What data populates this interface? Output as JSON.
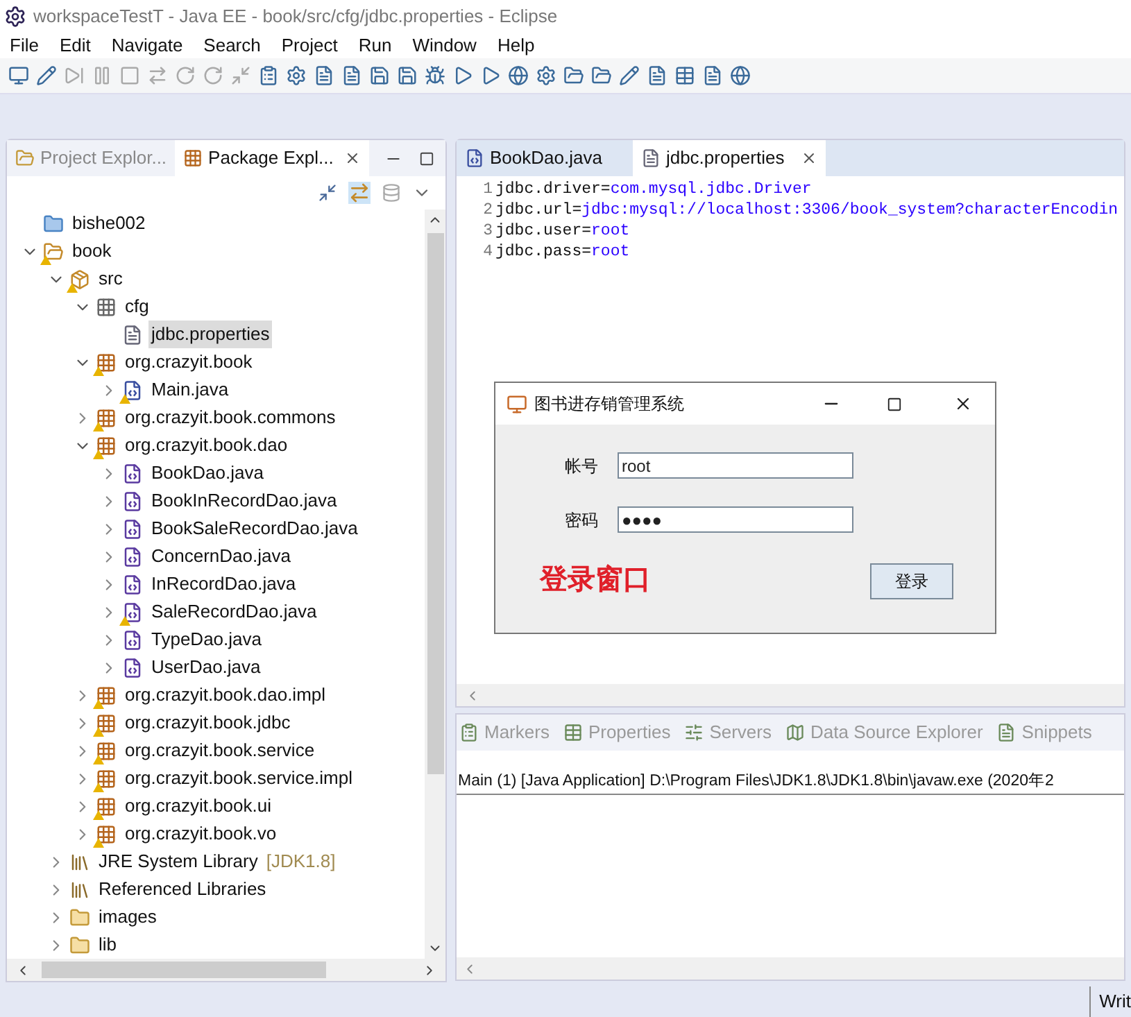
{
  "window": {
    "title": "workspaceTestT - Java EE - book/src/cfg/jdbc.properties - Eclipse"
  },
  "menu": [
    "File",
    "Edit",
    "Navigate",
    "Search",
    "Project",
    "Run",
    "Window",
    "Help"
  ],
  "left_tabs": [
    {
      "label": "Project Explor...",
      "selected": false,
      "closable": false
    },
    {
      "label": "Package Expl...",
      "selected": true,
      "closable": true
    }
  ],
  "tree": [
    {
      "label": "bishe002",
      "kind": "project",
      "has_children": false,
      "warning": false,
      "selected": false
    },
    {
      "label": "book",
      "kind": "java-project",
      "has_children": true,
      "expanded": true,
      "warning": true,
      "selected": false,
      "children": [
        {
          "label": "src",
          "kind": "source-folder",
          "has_children": true,
          "expanded": true,
          "warning": true,
          "selected": false,
          "children": [
            {
              "label": "cfg",
              "kind": "empty-package",
              "has_children": true,
              "expanded": true,
              "warning": false,
              "selected": false,
              "children": [
                {
                  "label": "jdbc.properties",
                  "kind": "file",
                  "has_children": false,
                  "warning": false,
                  "selected": true
                }
              ]
            },
            {
              "label": "org.crazyit.book",
              "kind": "package",
              "has_children": true,
              "expanded": true,
              "warning": true,
              "selected": false,
              "children": [
                {
                  "label": "Main.java",
                  "kind": "java",
                  "has_children": true,
                  "expanded": false,
                  "warning": true,
                  "selected": false
                }
              ]
            },
            {
              "label": "org.crazyit.book.commons",
              "kind": "package",
              "has_children": true,
              "expanded": false,
              "warning": true,
              "selected": false
            },
            {
              "label": "org.crazyit.book.dao",
              "kind": "package",
              "has_children": true,
              "expanded": true,
              "warning": true,
              "selected": false,
              "children": [
                {
                  "label": "BookDao.java",
                  "kind": "interface",
                  "has_children": true,
                  "expanded": false,
                  "warning": false,
                  "selected": false
                },
                {
                  "label": "BookInRecordDao.java",
                  "kind": "interface",
                  "has_children": true,
                  "expanded": false,
                  "warning": false,
                  "selected": false
                },
                {
                  "label": "BookSaleRecordDao.java",
                  "kind": "interface",
                  "has_children": true,
                  "expanded": false,
                  "warning": false,
                  "selected": false
                },
                {
                  "label": "ConcernDao.java",
                  "kind": "interface",
                  "has_children": true,
                  "expanded": false,
                  "warning": false,
                  "selected": false
                },
                {
                  "label": "InRecordDao.java",
                  "kind": "interface",
                  "has_children": true,
                  "expanded": false,
                  "warning": false,
                  "selected": false
                },
                {
                  "label": "SaleRecordDao.java",
                  "kind": "interface",
                  "has_children": true,
                  "expanded": false,
                  "warning": true,
                  "selected": false
                },
                {
                  "label": "TypeDao.java",
                  "kind": "interface",
                  "has_children": true,
                  "expanded": false,
                  "warning": false,
                  "selected": false
                },
                {
                  "label": "UserDao.java",
                  "kind": "interface",
                  "has_children": true,
                  "expanded": false,
                  "warning": false,
                  "selected": false
                }
              ]
            },
            {
              "label": "org.crazyit.book.dao.impl",
              "kind": "package",
              "has_children": true,
              "expanded": false,
              "warning": true,
              "selected": false
            },
            {
              "label": "org.crazyit.book.jdbc",
              "kind": "package",
              "has_children": true,
              "expanded": false,
              "warning": true,
              "selected": false
            },
            {
              "label": "org.crazyit.book.service",
              "kind": "package",
              "has_children": true,
              "expanded": false,
              "warning": true,
              "selected": false
            },
            {
              "label": "org.crazyit.book.service.impl",
              "kind": "package",
              "has_children": true,
              "expanded": false,
              "warning": true,
              "selected": false
            },
            {
              "label": "org.crazyit.book.ui",
              "kind": "package",
              "has_children": true,
              "expanded": false,
              "warning": true,
              "selected": false
            },
            {
              "label": "org.crazyit.book.vo",
              "kind": "package",
              "has_children": true,
              "expanded": false,
              "warning": true,
              "selected": false
            }
          ]
        },
        {
          "label": "JRE System Library",
          "decoration": "[JDK1.8]",
          "kind": "library",
          "has_children": true,
          "expanded": false,
          "warning": false,
          "selected": false
        },
        {
          "label": "Referenced Libraries",
          "kind": "library",
          "has_children": true,
          "expanded": false,
          "warning": false,
          "selected": false
        },
        {
          "label": "images",
          "kind": "folder",
          "has_children": true,
          "expanded": false,
          "warning": false,
          "selected": false
        },
        {
          "label": "lib",
          "kind": "folder",
          "has_children": true,
          "expanded": false,
          "warning": false,
          "selected": false
        }
      ]
    }
  ],
  "editor_tabs": [
    {
      "label": "BookDao.java",
      "kind": "java",
      "selected": false,
      "closable": false
    },
    {
      "label": "jdbc.properties",
      "kind": "file",
      "selected": true,
      "closable": true
    }
  ],
  "code": [
    {
      "number": "1",
      "key": "jdbc.driver=",
      "value": "com.mysql.jdbc.Driver"
    },
    {
      "number": "2",
      "key": "jdbc.url=",
      "value": "jdbc:mysql://localhost:3306/book_system?characterEncodin"
    },
    {
      "number": "3",
      "key": "jdbc.user=",
      "value": "root"
    },
    {
      "number": "4",
      "key": "jdbc.pass=",
      "value": "root"
    }
  ],
  "dialog": {
    "title": "图书进存销管理系统",
    "fields": [
      {
        "label": "帐号",
        "value": "root"
      },
      {
        "label": "密码",
        "value": "●●●●"
      }
    ],
    "annotation": "登录窗口",
    "button": "登录"
  },
  "bottom_tabs": [
    "Markers",
    "Properties",
    "Servers",
    "Data Source Explorer",
    "Snippets"
  ],
  "console": {
    "title": "Main (1) [Java Application] D:\\Program Files\\JDK1.8\\JDK1.8\\bin\\javaw.exe (2020年2"
  },
  "status_bar": {
    "text": "Writ"
  }
}
